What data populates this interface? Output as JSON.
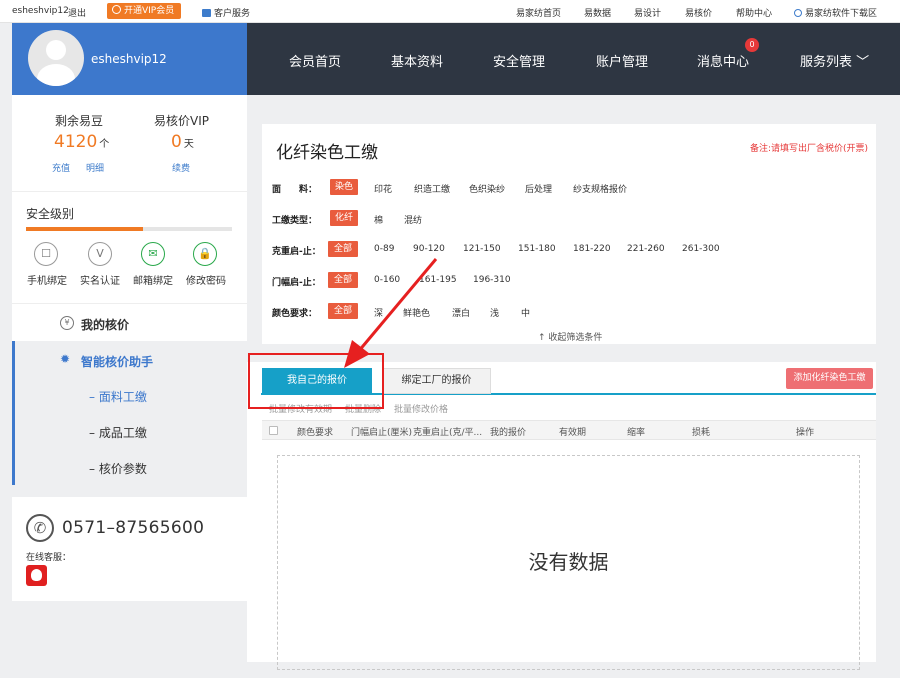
{
  "topbar": {
    "username": "esheshvip12",
    "logout": "退出",
    "vip_button": "开通VIP会员",
    "customer_service": "客户服务",
    "links": [
      "易家纺首页",
      "易数据",
      "易设计",
      "易核价",
      "帮助中心"
    ],
    "download": "易家纺软件下载区"
  },
  "profile": {
    "name": "esheshvip12"
  },
  "nav": {
    "items": [
      "会员首页",
      "基本资料",
      "安全管理",
      "账户管理",
      "消息中心",
      "服务列表 ﹀"
    ],
    "message_count": "0"
  },
  "account": {
    "beans_label": "剩余易豆",
    "beans_value": "4120",
    "beans_unit": "个",
    "recharge": "充值",
    "detail": "明细",
    "vip_label": "易核价VIP",
    "vip_value": "0",
    "vip_unit": "天",
    "renew": "续费",
    "security_label": "安全级别",
    "security_level": 0.57,
    "security_items": [
      "手机绑定",
      "实名认证",
      "邮箱绑定",
      "修改密码"
    ]
  },
  "menu": {
    "my_pricing": "我的核价",
    "smart_assistant": "智能核价助手",
    "subitems": [
      "面料工缴",
      "成品工缴",
      "核价参数"
    ]
  },
  "contact": {
    "phone": "0571–87565600",
    "online_label": "在线客服："
  },
  "filter": {
    "title": "化纤染色工缴",
    "note": "备注:请填写出厂含税价(开票)",
    "rows": [
      {
        "label": "面　　料：",
        "selected": "染色",
        "options": [
          "印花",
          "织造工缴",
          "色织染纱",
          "后处理",
          "纱支规格报价"
        ]
      },
      {
        "label": "工缴类型：",
        "selected": "化纤",
        "options": [
          "棉",
          "混纺"
        ]
      },
      {
        "label": "克重启-止：",
        "selected": "全部",
        "options": [
          "0-89",
          "90-120",
          "121-150",
          "151-180",
          "181-220",
          "221-260",
          "261-300"
        ]
      },
      {
        "label": "门幅启-止：",
        "selected": "全部",
        "options": [
          "0-160",
          "161-195",
          "196-310"
        ]
      },
      {
        "label": "颜色要求：",
        "selected": "全部",
        "options": [
          "深",
          "鲜艳色",
          "漂白",
          "浅",
          "中"
        ]
      }
    ],
    "collapse": "↑ 收起筛选条件"
  },
  "tabs": {
    "tab1": "我自己的报价",
    "tab2": "绑定工厂的报价",
    "add_button": "添加化纤染色工缴",
    "actions": [
      "批量修改有效期",
      "批量删除",
      "批量修改价格"
    ],
    "columns": [
      "颜色要求",
      "门幅启止(厘米)",
      "克重启止(克/平...",
      "我的报价",
      "有效期",
      "缩率",
      "损耗",
      "操作"
    ],
    "empty": "没有数据"
  }
}
